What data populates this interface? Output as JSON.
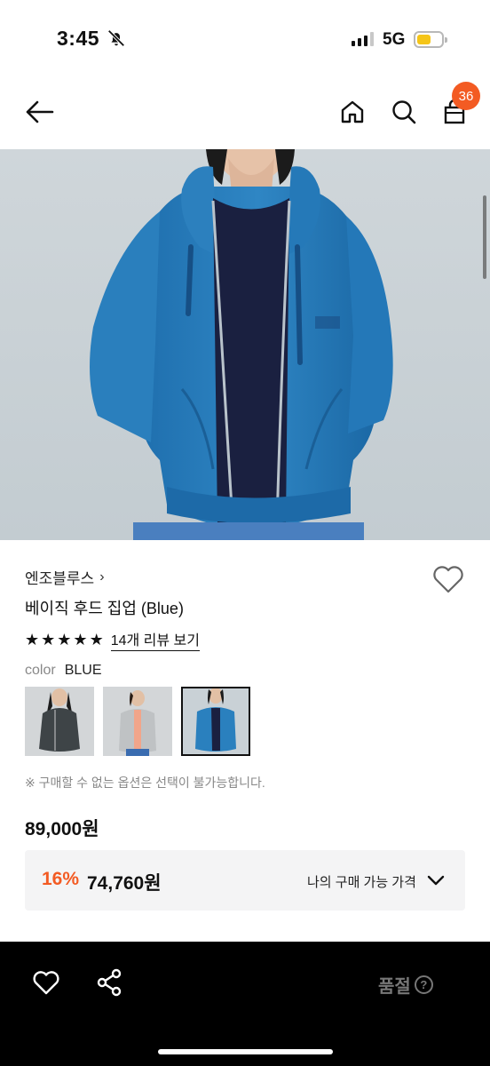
{
  "status_bar": {
    "time": "3:45",
    "network": "5G",
    "icons": [
      "bell-slash-icon",
      "cellular-signal-icon",
      "battery-icon"
    ],
    "battery_level": 0.58
  },
  "nav": {
    "icons": [
      "back-arrow-icon",
      "home-icon",
      "search-icon",
      "cart-icon"
    ],
    "cart_count": "36",
    "accent_color": "#f35b23"
  },
  "product": {
    "brand": "엔조블루스",
    "brand_chevron": "›",
    "title": "베이직 후드 집업 (Blue)",
    "rating_stars": 5,
    "review_link": "14개 리뷰 보기",
    "color_label": "color",
    "color_value": "BLUE",
    "swatches": [
      {
        "name": "charcoal",
        "selected": false
      },
      {
        "name": "gray",
        "selected": false
      },
      {
        "name": "blue",
        "selected": true
      }
    ],
    "option_note": "※ 구매할 수 없는 옵션은 선택이 불가능합니다.",
    "price": "89,000원",
    "discount_rate": "16%",
    "discount_price": "74,760원",
    "my_price_label": "나의 구매 가능 가격"
  },
  "bottom_bar": {
    "icons": [
      "heart-icon",
      "share-icon",
      "help-icon"
    ],
    "soldout_label": "품절",
    "help_glyph": "?"
  }
}
